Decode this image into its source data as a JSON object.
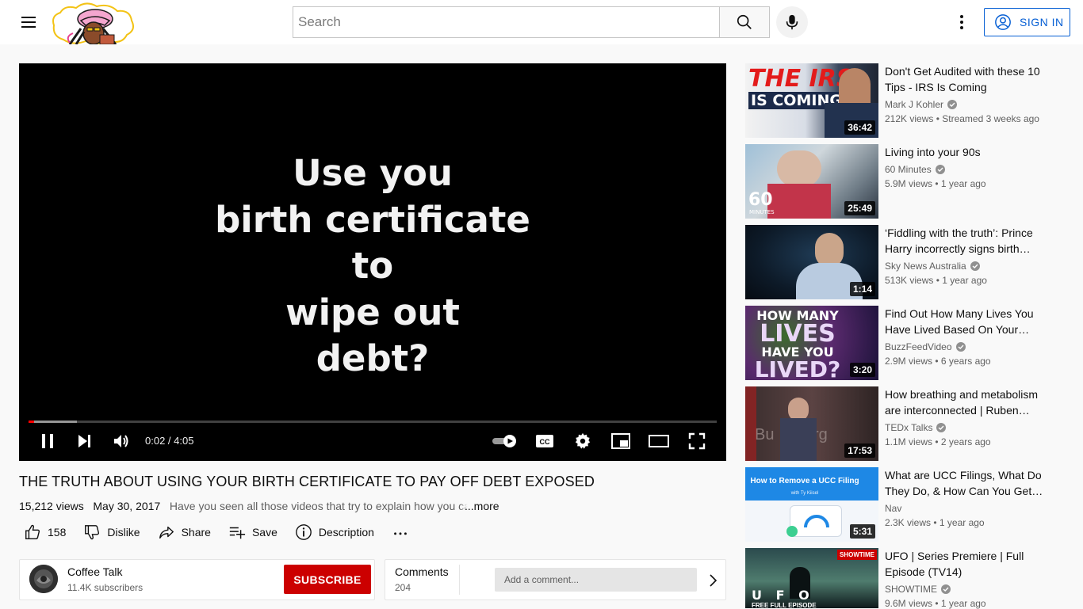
{
  "header": {
    "search_placeholder": "Search",
    "signin_label": "SIGN IN",
    "icons": [
      "menu-icon",
      "search-icon",
      "mic-icon",
      "more-vert-icon",
      "account-circle-icon"
    ]
  },
  "player": {
    "video_text": "Use you\nbirth certificate\nto\nwipe out\ndebt?",
    "time": "0:02 / 4:05",
    "progress_played": 0.008,
    "progress_buffered": 0.07,
    "accent_color": "#ff0000"
  },
  "video": {
    "title": "THE TRUTH ABOUT USING YOUR BIRTH CERTIFICATE TO PAY OFF DEBT EXPOSED",
    "views": "15,212 views",
    "date": "May 30, 2017",
    "description": "Have you seen all those videos that try to explain how you ca",
    "more_label": "...more"
  },
  "actions": {
    "like_count": "158",
    "dislike_label": "Dislike",
    "share_label": "Share",
    "save_label": "Save",
    "description_label": "Description"
  },
  "channel": {
    "name": "Coffee Talk",
    "subscribers": "11.4K subscribers",
    "subscribe_label": "SUBSCRIBE"
  },
  "comments": {
    "label": "Comments",
    "count": "204",
    "placeholder": "Add a comment..."
  },
  "recommendations": [
    {
      "title_l1": "Don't Get Audited with these 10",
      "title_l2": "Tips - IRS Is Coming",
      "channel": "Mark J Kohler",
      "verified": true,
      "meta": "212K views • Streamed 3 weeks ago",
      "duration": "36:42",
      "thumb_text": "THE IRS",
      "thumb_text2": "IS COMING"
    },
    {
      "title_l1": "Living into your 90s",
      "title_l2": "",
      "channel": "60 Minutes",
      "verified": true,
      "meta": "5.9M views • 1 year ago",
      "duration": "25:49",
      "thumb_text": "60",
      "thumb_text2": "MINUTES"
    },
    {
      "title_l1": "‘Fiddling with the truth’: Prince",
      "title_l2": "Harry incorrectly signs birth…",
      "channel": "Sky News Australia",
      "verified": true,
      "meta": "513K views • 1 year ago",
      "duration": "1:14",
      "thumb_text": "",
      "thumb_text2": ""
    },
    {
      "title_l1": "Find Out How Many Lives You",
      "title_l2": "Have Lived Based On Your…",
      "channel": "BuzzFeedVideo",
      "verified": true,
      "meta": "2.9M views • 6 years ago",
      "duration": "3:20",
      "thumb_text": "HOW MANY",
      "thumb_text2": "LIVES",
      "thumb_text3": "HAVE YOU",
      "thumb_text4": "LIVED?"
    },
    {
      "title_l1": "How breathing and metabolism",
      "title_l2": "are interconnected | Ruben…",
      "channel": "TEDx Talks",
      "verified": true,
      "meta": "1.1M views • 2 years ago",
      "duration": "17:53",
      "thumb_text": "Bu",
      "thumb_text2": "rg"
    },
    {
      "title_l1": "What are UCC Filings, What Do",
      "title_l2": "They Do, & How Can You Get…",
      "channel": "Nav",
      "verified": false,
      "meta": "2.3K views • 1 year ago",
      "duration": "5:31",
      "thumb_text": "How to Remove a UCC Filing",
      "thumb_text2": "with Ty Kiisel"
    },
    {
      "title_l1": "UFO | Series Premiere | Full",
      "title_l2": "Episode (TV14)",
      "channel": "SHOWTIME",
      "verified": true,
      "meta": "9.6M views • 1 year ago",
      "duration": "",
      "thumb_text": "U F O",
      "thumb_text2": "SHOWTIME",
      "thumb_text3": "FREE FULL EPISODE"
    }
  ]
}
